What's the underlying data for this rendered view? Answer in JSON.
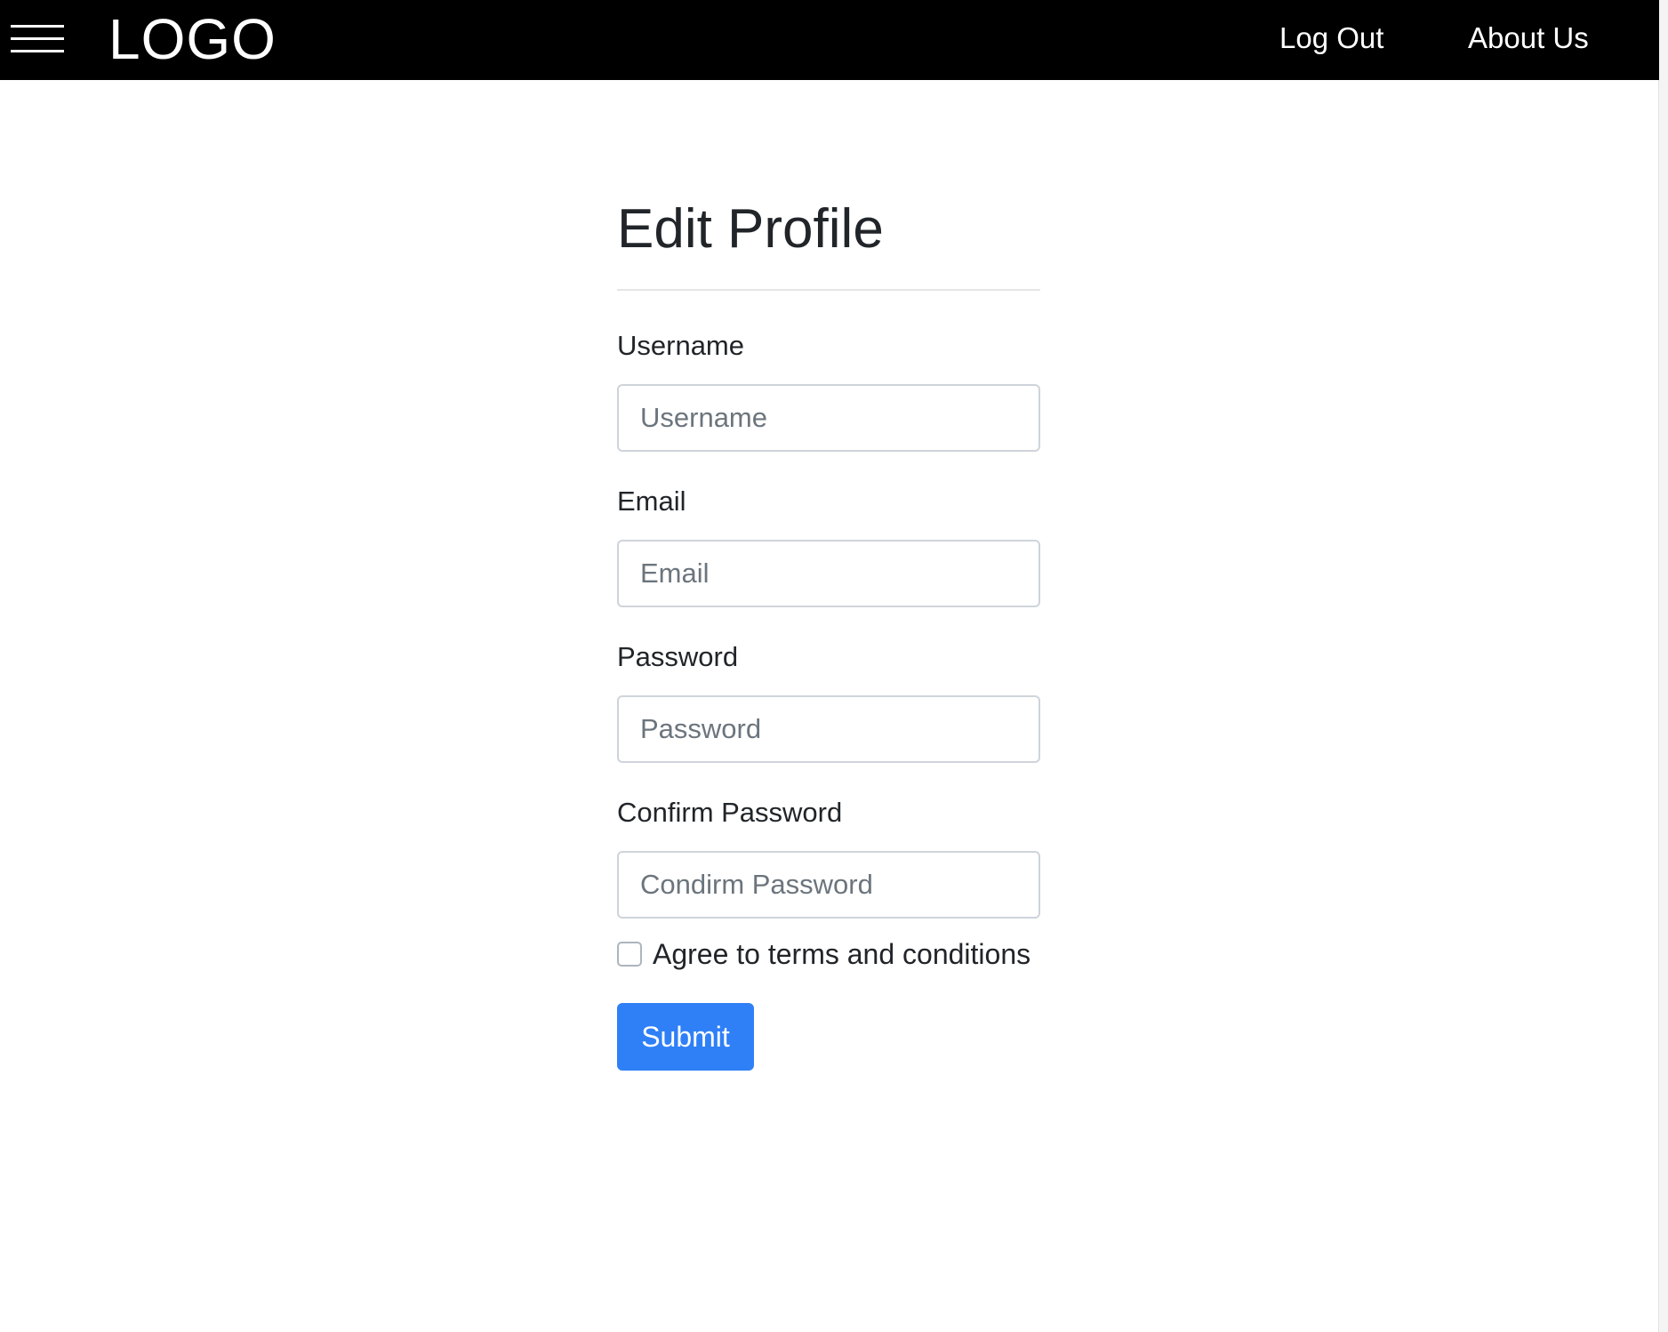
{
  "navbar": {
    "logo": "LOGO",
    "links": [
      "Log Out",
      "About Us"
    ]
  },
  "form": {
    "title": "Edit Profile",
    "fields": [
      {
        "label": "Username",
        "placeholder": "Username"
      },
      {
        "label": "Email",
        "placeholder": "Email"
      },
      {
        "label": "Password",
        "placeholder": "Password"
      },
      {
        "label": "Confirm Password",
        "placeholder": "Condirm Password"
      }
    ],
    "terms_label": "Agree to terms and conditions",
    "terms_checked": false,
    "submit_label": "Submit"
  },
  "colors": {
    "navbar_bg": "#000000",
    "primary": "#2f80f7"
  }
}
